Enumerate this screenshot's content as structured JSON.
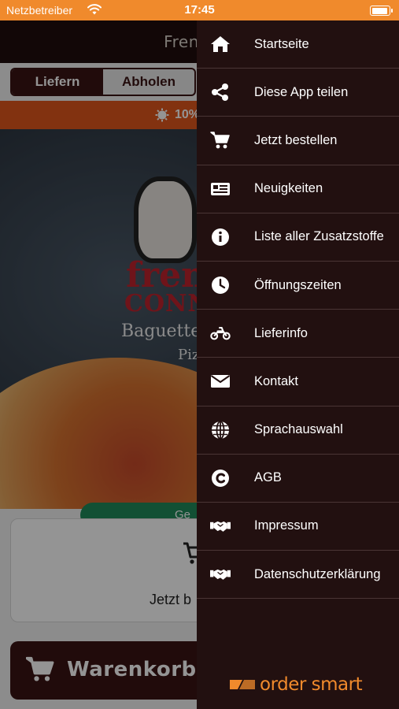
{
  "status_bar": {
    "carrier": "Netzbetreiber",
    "time": "17:45",
    "background_color": "#f08a2c"
  },
  "background_app": {
    "header_title": "French C",
    "tabs": [
      {
        "label": "Liefern",
        "active": true
      },
      {
        "label": "Abholen",
        "active": false
      }
    ],
    "promo_text": "10%",
    "hero_button_label": "Ge",
    "order_card_label": "Jetzt b",
    "cart_button_label": "Warenkorb",
    "brand_color": "#3a1414"
  },
  "drawer": {
    "background_color": "#221010",
    "items": [
      {
        "label": "Startseite",
        "icon": "home-icon"
      },
      {
        "label": "Diese App teilen",
        "icon": "share-icon"
      },
      {
        "label": "Jetzt bestellen",
        "icon": "cart-icon"
      },
      {
        "label": "Neuigkeiten",
        "icon": "newspaper-icon"
      },
      {
        "label": "Liste aller Zusatzstoffe",
        "icon": "info-icon"
      },
      {
        "label": "Öffnungszeiten",
        "icon": "clock-icon"
      },
      {
        "label": "Lieferinfo",
        "icon": "motorcycle-icon"
      },
      {
        "label": "Kontakt",
        "icon": "envelope-icon"
      },
      {
        "label": "Sprachauswahl",
        "icon": "globe-icon"
      },
      {
        "label": "AGB",
        "icon": "copyright-icon"
      },
      {
        "label": "Impressum",
        "icon": "handshake-icon"
      },
      {
        "label": "Datenschutzerklärung",
        "icon": "handshake-icon"
      }
    ],
    "brand_text": "order smart",
    "brand_color": "#f08a2c"
  }
}
